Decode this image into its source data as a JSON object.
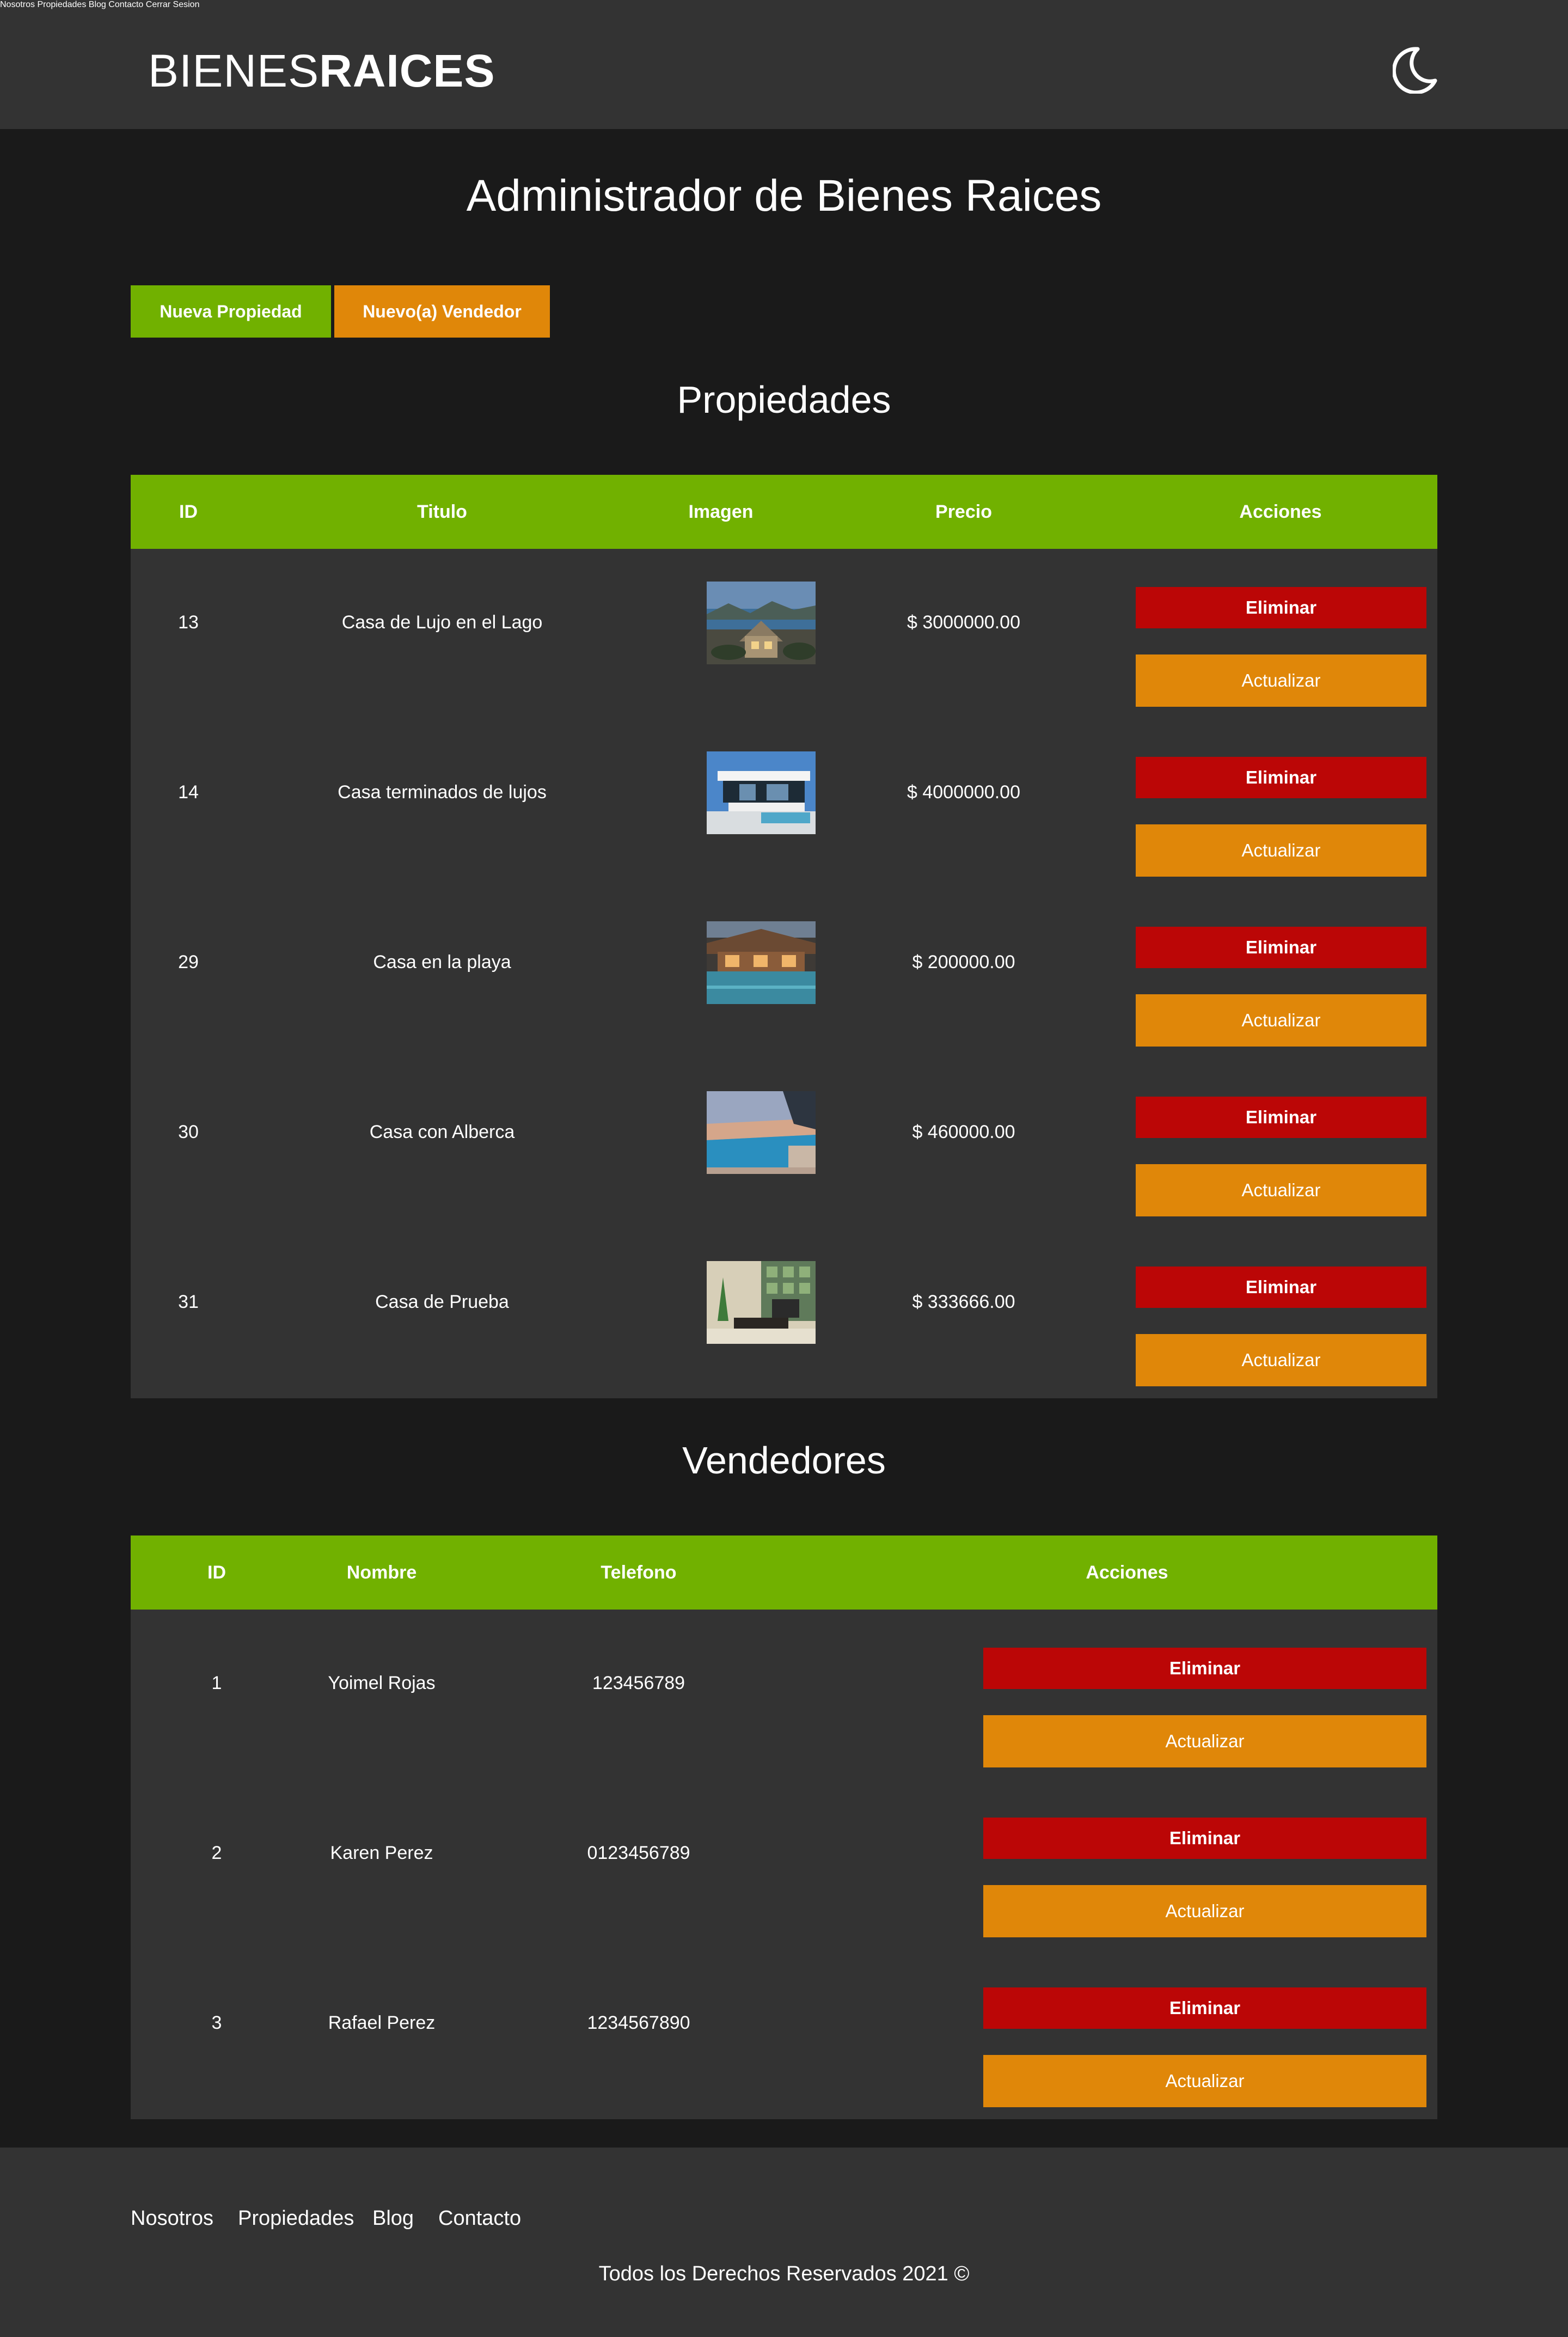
{
  "header": {
    "logo_thin": "BIENES",
    "logo_bold": "RAICES",
    "nav": [
      "Nosotros",
      "Propiedades",
      "Blog",
      "Contacto",
      "Cerrar Sesion"
    ],
    "theme_icon": "moon-icon"
  },
  "page_title": "Administrador de Bienes Raices",
  "actions": {
    "new_property": "Nueva Propiedad",
    "new_seller": "Nuevo(a) Vendedor"
  },
  "properties": {
    "title": "Propiedades",
    "columns": [
      "ID",
      "Titulo",
      "Imagen",
      "Precio",
      "Acciones"
    ],
    "rows": [
      {
        "id": "13",
        "title": "Casa de Lujo en el Lago",
        "price": "$ 3000000.00",
        "image": "lake-house"
      },
      {
        "id": "14",
        "title": "Casa terminados de lujos",
        "price": "$ 4000000.00",
        "image": "modern-house"
      },
      {
        "id": "29",
        "title": "Casa en la playa",
        "price": "$ 200000.00",
        "image": "beach-house"
      },
      {
        "id": "30",
        "title": "Casa con Alberca",
        "price": "$ 460000.00",
        "image": "pool-house"
      },
      {
        "id": "31",
        "title": "Casa de Prueba",
        "price": "$ 333666.00",
        "image": "living-room"
      }
    ],
    "delete_label": "Eliminar",
    "update_label": "Actualizar"
  },
  "sellers": {
    "title": "Vendedores",
    "columns": [
      "ID",
      "Nombre",
      "Telefono",
      "Acciones"
    ],
    "rows": [
      {
        "id": "1",
        "name": "Yoimel Rojas",
        "phone": "123456789"
      },
      {
        "id": "2",
        "name": "Karen Perez",
        "phone": "0123456789"
      },
      {
        "id": "3",
        "name": "Rafael Perez",
        "phone": "1234567890"
      }
    ],
    "delete_label": "Eliminar",
    "update_label": "Actualizar"
  },
  "footer": {
    "nav": [
      "Nosotros",
      "Propiedades",
      "Blog",
      "Contacto"
    ],
    "copyright": "Todos los Derechos Reservados 2021 ©"
  },
  "colors": {
    "background": "#1a1a1a",
    "header": "#333333",
    "green": "#71b100",
    "orange": "#e08709",
    "red": "#bb0606"
  }
}
